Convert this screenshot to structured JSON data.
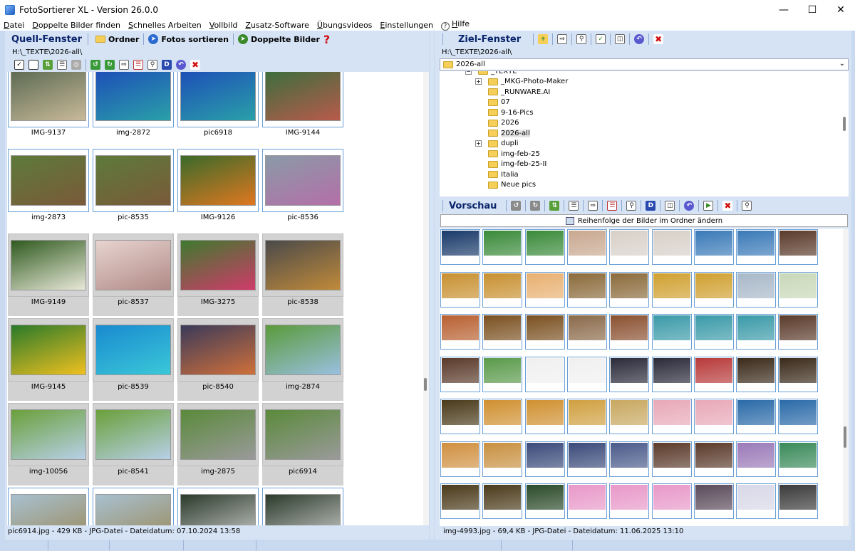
{
  "window": {
    "title": "FotoSortierer XL - Version 26.0.0",
    "controls": [
      "—",
      "☐",
      "✕"
    ]
  },
  "menu": [
    {
      "u": "D",
      "rest": "atei"
    },
    {
      "u": "D",
      "rest": "oppelte Bilder finden"
    },
    {
      "u": "S",
      "rest": "chnelles Arbeiten"
    },
    {
      "u": "V",
      "rest": "ollbild"
    },
    {
      "u": "Z",
      "rest": "usatz-Software"
    },
    {
      "u": "Ü",
      "rest": "bungsvideos"
    },
    {
      "u": "E",
      "rest": "instellungen"
    },
    {
      "u": "H",
      "rest": "ilfe"
    }
  ],
  "source": {
    "title": "Quell-Fenster",
    "btn_folder": "Ordner",
    "btn_sort": "Fotos sortieren",
    "btn_dupes": "Doppelte Bilder",
    "path": "H:\\_TEXTE\\2026-all\\",
    "status": "pic6914.jpg - 429 KB - JPG-Datei - Dateidatum: 07.10.2024 13:58",
    "items": [
      {
        "name": "IMG-9137",
        "state": "sel",
        "c1": "#5c6b52",
        "c2": "#c9b99a"
      },
      {
        "name": "img-2872",
        "state": "sel",
        "c1": "#1d4fb8",
        "c2": "#2aa0a8"
      },
      {
        "name": "pic6918",
        "state": "sel",
        "c1": "#1d4fb8",
        "c2": "#2aa0a8"
      },
      {
        "name": "IMG-9144",
        "state": "sel",
        "c1": "#3c6e3c",
        "c2": "#b85a4c"
      },
      {
        "name": "img-2873",
        "state": "sel",
        "c1": "#5d7a3a",
        "c2": "#7a5a3a"
      },
      {
        "name": "pic-8535",
        "state": "sel",
        "c1": "#5d7a3a",
        "c2": "#7a5a3a"
      },
      {
        "name": "IMG-9126",
        "state": "sel",
        "c1": "#3a6a2a",
        "c2": "#e07820"
      },
      {
        "name": "pic-8536",
        "state": "sel",
        "c1": "#8a9aa8",
        "c2": "#b46fa8"
      },
      {
        "name": "IMG-9149",
        "state": "grey",
        "c1": "#2f5a1f",
        "c2": "#e8e8d8"
      },
      {
        "name": "pic-8537",
        "state": "grey",
        "c1": "#e8d4d0",
        "c2": "#b08a86"
      },
      {
        "name": "IMG-3275",
        "state": "grey",
        "c1": "#3e7a2e",
        "c2": "#d03a6a"
      },
      {
        "name": "pic-8538",
        "state": "grey",
        "c1": "#4a4a4a",
        "c2": "#c08a3a"
      },
      {
        "name": "IMG-9145",
        "state": "grey",
        "c1": "#2a7a2a",
        "c2": "#f0c020"
      },
      {
        "name": "pic-8539",
        "state": "grey",
        "c1": "#1a8ad0",
        "c2": "#3ac8d8"
      },
      {
        "name": "pic-8540",
        "state": "grey",
        "c1": "#3a3a5a",
        "c2": "#d0703a"
      },
      {
        "name": "img-2874",
        "state": "grey",
        "c1": "#5a9a3a",
        "c2": "#9ac0e0"
      },
      {
        "name": "img-10056",
        "state": "grey",
        "c1": "#6aa03a",
        "c2": "#b8d0e8"
      },
      {
        "name": "pic-8541",
        "state": "grey",
        "c1": "#6aa03a",
        "c2": "#b8d0e8"
      },
      {
        "name": "img-2875",
        "state": "grey",
        "c1": "#5a8a3a",
        "c2": "#9a9a9a"
      },
      {
        "name": "pic6914",
        "state": "grey",
        "c1": "#5a8a3a",
        "c2": "#9a9a9a"
      },
      {
        "name": "",
        "state": "sel",
        "c1": "#a8c0d0",
        "c2": "#9a8a5a"
      },
      {
        "name": "",
        "state": "sel",
        "c1": "#a8c0d0",
        "c2": "#9a8a5a"
      },
      {
        "name": "",
        "state": "sel",
        "c1": "#2a3a2a",
        "c2": "#d0d0d0"
      },
      {
        "name": "",
        "state": "sel",
        "c1": "#2a3a2a",
        "c2": "#d0d0d0"
      }
    ]
  },
  "target": {
    "title": "Ziel-Fenster",
    "path": "H:\\_TEXTE\\2026-all\\",
    "combo_value": "2026-all",
    "tree": [
      {
        "label": "_TEXTE",
        "level": 0,
        "pm": "−",
        "sel": false
      },
      {
        "label": "_MKG-Photo-Maker",
        "level": 1,
        "pm": "+",
        "sel": false
      },
      {
        "label": "_RUNWARE.AI",
        "level": 1,
        "pm": "",
        "sel": false
      },
      {
        "label": "07",
        "level": 1,
        "pm": "",
        "sel": false
      },
      {
        "label": "9-16-Pics",
        "level": 1,
        "pm": "",
        "sel": false
      },
      {
        "label": "2026",
        "level": 1,
        "pm": "",
        "sel": false
      },
      {
        "label": "2026-all",
        "level": 1,
        "pm": "",
        "sel": true
      },
      {
        "label": "dupli",
        "level": 1,
        "pm": "+",
        "sel": false
      },
      {
        "label": "img-feb-25",
        "level": 1,
        "pm": "",
        "sel": false
      },
      {
        "label": "img-feb-25-II",
        "level": 1,
        "pm": "",
        "sel": false
      },
      {
        "label": "Italia",
        "level": 1,
        "pm": "",
        "sel": false
      },
      {
        "label": "Neue pics",
        "level": 1,
        "pm": "",
        "sel": false
      }
    ]
  },
  "preview": {
    "title": "Vorschau",
    "order_button": "Reihenfolge der Bilder im Ordner ändern",
    "status": "img-4993.jpg - 69,4 KB - JPG-Datei - Dateidatum: 11.06.2025 13:10",
    "colors": [
      [
        "#1a3a6a",
        "#3a8a3a",
        "#3a8a3a",
        "#c8a890",
        "#d8d0c8",
        "#d8d0c8",
        "#3a7ab8",
        "#3a7ab8",
        "#5a3a2a"
      ],
      [
        "#c89030",
        "#c89030",
        "#e8b070",
        "#8a6a3a",
        "#8a6a3a",
        "#d0a030",
        "#d0a030",
        "#a8b8c8",
        "#c8d8b8"
      ],
      [
        "#b86030",
        "#7a5020",
        "#7a5020",
        "#8a6a4a",
        "#8a5030",
        "#3a9aa8",
        "#3a9aa8",
        "#3a9aa8",
        "#5a3a2a"
      ],
      [
        "#5a3a2a",
        "#5a9a4a",
        "#f0f0f0",
        "#f0f0f0",
        "#2a2a3a",
        "#2a2a3a",
        "#b83a3a",
        "#3a2a1a",
        "#3a2a1a"
      ],
      [
        "#4a3a1a",
        "#d09030",
        "#d09030",
        "#d0a040",
        "#c8a860",
        "#e8a8b8",
        "#e8a8b8",
        "#2a6aa8",
        "#2a6aa8"
      ],
      [
        "#d09040",
        "#c89040",
        "#3a4a7a",
        "#3a4a7a",
        "#4a5a8a",
        "#5a3a2a",
        "#5a3a2a",
        "#9a7ab8",
        "#3a8a5a"
      ],
      [
        "#4a3a1a",
        "#4a3a1a",
        "#2a4a2a",
        "#e898c8",
        "#e898c8",
        "#e898c8",
        "#5a4a5a",
        "#d8d8e8",
        "#3a3a3a"
      ],
      [
        "#aaaaaa",
        "#aaaaaa",
        "#aaaaaa",
        "#aaaaaa",
        "#aaaaaa",
        "#aaaaaa",
        "#aaaaaa",
        "#aaaaaa",
        "#aaaaaa"
      ]
    ]
  }
}
